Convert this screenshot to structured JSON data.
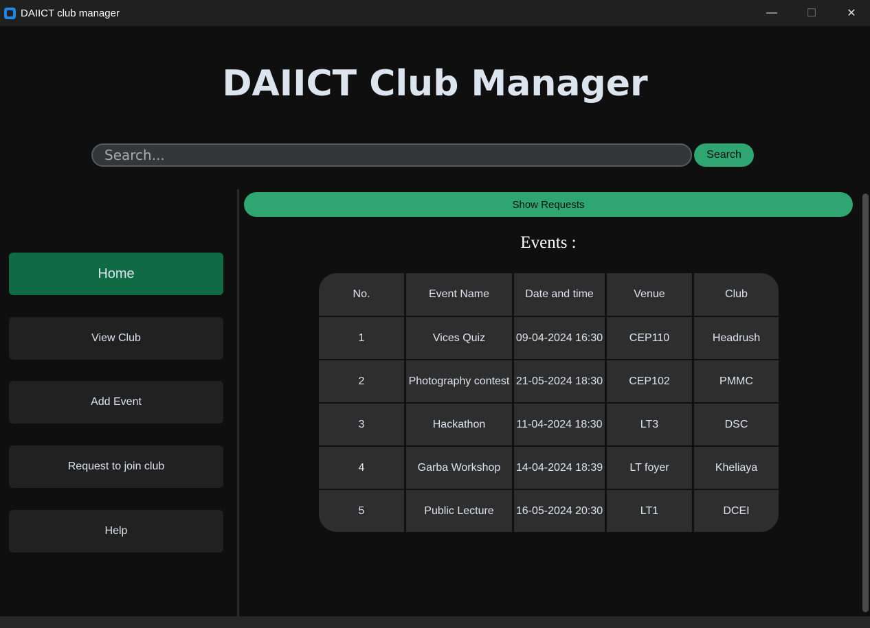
{
  "window": {
    "title": "DAIICT club manager",
    "minimize": "—",
    "maximize": "☐",
    "close": "✕"
  },
  "header": {
    "title": "DAIICT Club Manager"
  },
  "search": {
    "placeholder": "Search...",
    "button": "Search"
  },
  "sidebar": {
    "items": [
      {
        "label": "Home",
        "active": true
      },
      {
        "label": "View Club"
      },
      {
        "label": "Add Event"
      },
      {
        "label": "Request to join club"
      },
      {
        "label": "Help"
      }
    ]
  },
  "main": {
    "show_requests": "Show Requests",
    "events_title": "Events :",
    "table": {
      "headers": [
        "No.",
        "Event Name",
        "Date and time",
        "Venue",
        "Club"
      ],
      "rows": [
        [
          "1",
          "Vices Quiz",
          "09-04-2024 16:30",
          "CEP110",
          "Headrush"
        ],
        [
          "2",
          "Photography contest",
          "21-05-2024 18:30",
          "CEP102",
          "PMMC"
        ],
        [
          "3",
          "Hackathon",
          "11-04-2024 18:30",
          "LT3",
          "DSC"
        ],
        [
          "4",
          "Garba Workshop",
          "14-04-2024 18:39",
          "LT foyer",
          "Kheliaya"
        ],
        [
          "5",
          "Public Lecture",
          "16-05-2024 20:30",
          "LT1",
          "DCEI"
        ]
      ]
    }
  },
  "colors": {
    "accent": "#2fa572",
    "active_nav": "#106a43"
  }
}
